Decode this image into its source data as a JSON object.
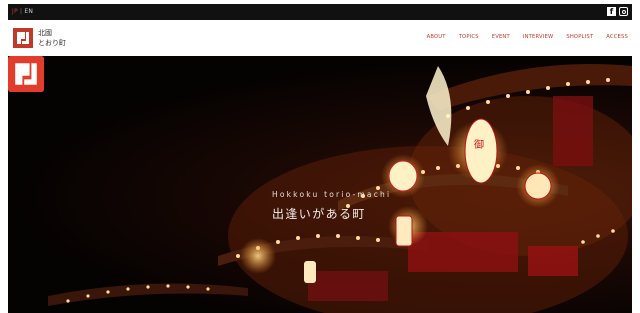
{
  "topbar": {
    "lang_ja": "JP",
    "lang_sep": "|",
    "lang_en": "EN",
    "social_icons": [
      "facebook-icon",
      "instagram-icon"
    ]
  },
  "header": {
    "logo_line1": "北國",
    "logo_line2": "とおり町",
    "brand_color": "#c0392b"
  },
  "nav": {
    "items": [
      "ABOUT",
      "TOPICS",
      "EVENT",
      "INTERVIEW",
      "SHOPLIST",
      "ACCESS"
    ]
  },
  "hero": {
    "brand": "Hokkoku torio-machi",
    "tagline": "出逢いがある町"
  }
}
